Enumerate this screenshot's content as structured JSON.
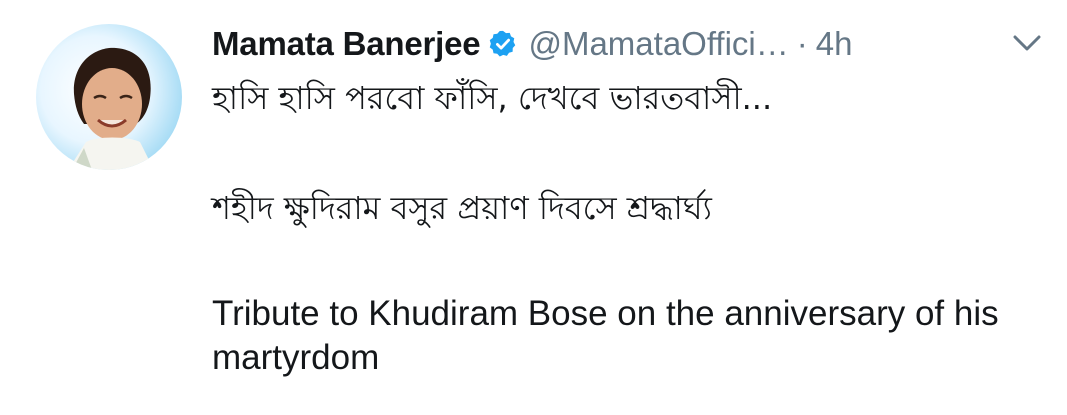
{
  "tweet": {
    "display_name": "Mamata Banerjee",
    "handle": "@MamataOffici…",
    "separator": "·",
    "timestamp": "4h",
    "verified": true,
    "icons": {
      "verified": "verified-badge-icon",
      "menu": "chevron-down-icon"
    },
    "text": {
      "line1": "হাসি হাসি পরবো ফাঁসি, দেখবে ভারতবাসী...",
      "line2": "শহীদ ক্ষুদিরাম বসুর প্রয়াণ দিবসে শ্রদ্ধার্ঘ্য",
      "line3": "Tribute to Khudiram Bose on the anniversary of his martyrdom"
    },
    "colors": {
      "name": "#14171a",
      "secondary": "#657786",
      "verified_blue": "#1da1f2"
    }
  }
}
